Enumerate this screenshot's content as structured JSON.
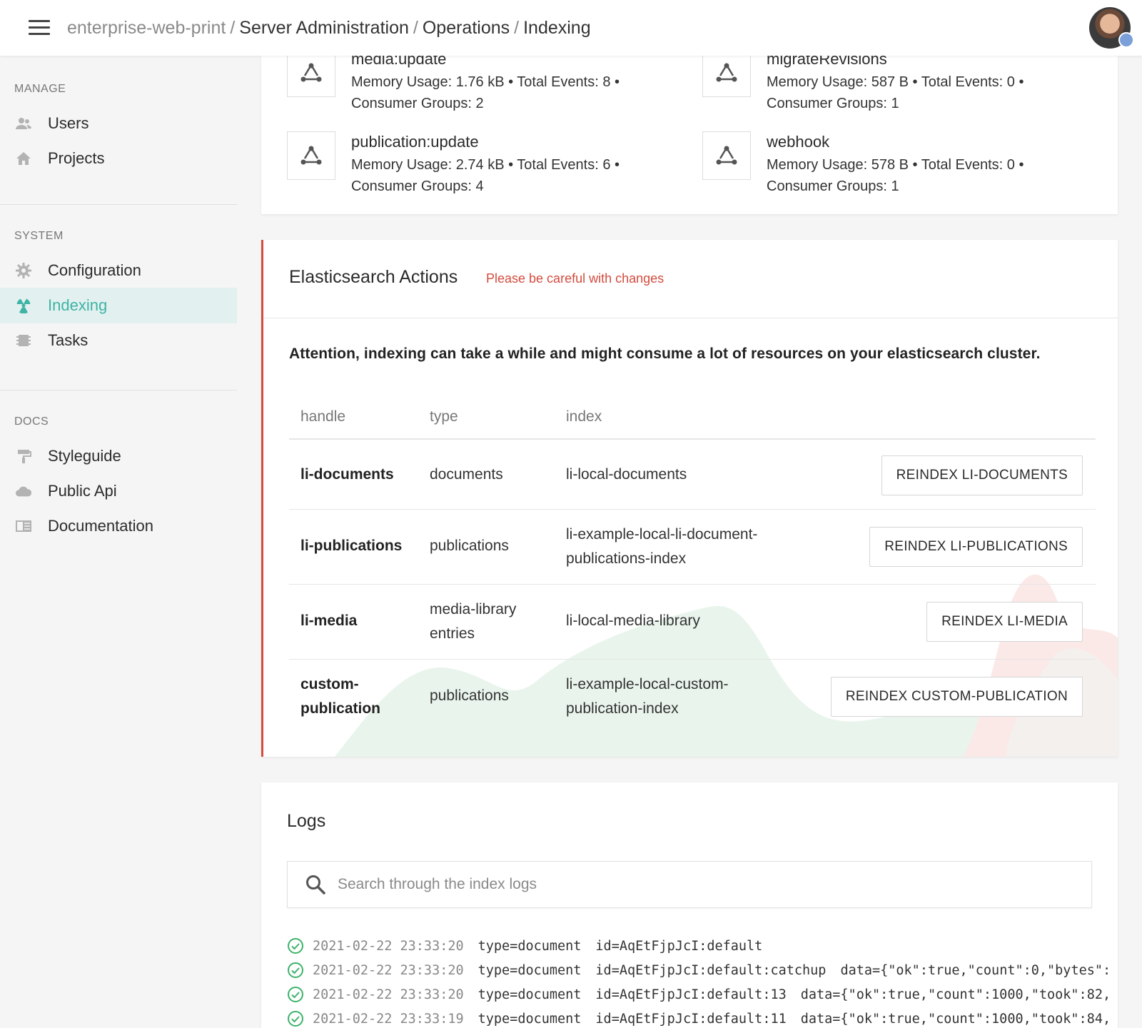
{
  "header": {
    "breadcrumb_root": "enterprise-web-print",
    "breadcrumb_sep": "/",
    "breadcrumbs": [
      "Server Administration",
      "Operations",
      "Indexing"
    ]
  },
  "sidebar": {
    "sections": [
      {
        "heading": "MANAGE",
        "items": [
          {
            "label": "Users",
            "icon": "users-icon"
          },
          {
            "label": "Projects",
            "icon": "home-icon"
          }
        ]
      },
      {
        "heading": "SYSTEM",
        "items": [
          {
            "label": "Configuration",
            "icon": "gear-icon"
          },
          {
            "label": "Indexing",
            "icon": "radiation-icon",
            "active": true
          },
          {
            "label": "Tasks",
            "icon": "chip-icon"
          }
        ]
      },
      {
        "heading": "DOCS",
        "items": [
          {
            "label": "Styleguide",
            "icon": "paint-roller-icon"
          },
          {
            "label": "Public Api",
            "icon": "cloud-icon"
          },
          {
            "label": "Documentation",
            "icon": "book-icon"
          }
        ]
      }
    ]
  },
  "streams": [
    {
      "name": "media:update",
      "line1": "Memory Usage: 1.76 kB • Total Events: 8 •",
      "line2": "Consumer Groups: 2"
    },
    {
      "name": "migrateRevisions",
      "line1": "Memory Usage: 587 B • Total Events: 0 •",
      "line2": "Consumer Groups: 1"
    },
    {
      "name": "publication:update",
      "line1": "Memory Usage: 2.74 kB • Total Events: 6 •",
      "line2": "Consumer Groups: 4"
    },
    {
      "name": "webhook",
      "line1": "Memory Usage: 578 B • Total Events: 0 •",
      "line2": "Consumer Groups: 1"
    }
  ],
  "es_actions": {
    "title": "Elasticsearch Actions",
    "warning": "Please be careful with changes",
    "attention": "Attention, indexing can take a while and might consume a lot of resources on your elasticsearch cluster.",
    "columns": [
      "handle",
      "type",
      "index"
    ],
    "rows": [
      {
        "handle": [
          "li-documents"
        ],
        "type": [
          "documents"
        ],
        "index": [
          "li-local-documents"
        ],
        "button": "REINDEX LI-DOCUMENTS"
      },
      {
        "handle": [
          "li-publications"
        ],
        "type": [
          "publications"
        ],
        "index": [
          "li-example-local-li-document-",
          "publications-index"
        ],
        "button": "REINDEX LI-PUBLICATIONS"
      },
      {
        "handle": [
          "li-media"
        ],
        "type": [
          "media-library",
          "entries"
        ],
        "index": [
          "li-local-media-library"
        ],
        "button": "REINDEX LI-MEDIA"
      },
      {
        "handle": [
          "custom-",
          "publication"
        ],
        "type": [
          "publications"
        ],
        "index": [
          "li-example-local-custom-",
          "publication-index"
        ],
        "button": "REINDEX CUSTOM-PUBLICATION"
      }
    ]
  },
  "logs": {
    "title": "Logs",
    "search_placeholder": "Search through the index logs",
    "entries": [
      {
        "ts": "2021-02-22 23:33:20",
        "type": "type=document",
        "id": "id=AqEtFjpJcI:default",
        "data": ""
      },
      {
        "ts": "2021-02-22 23:33:20",
        "type": "type=document",
        "id": "id=AqEtFjpJcI:default:catchup",
        "data": "data={\"ok\":true,\"count\":0,\"bytes\":"
      },
      {
        "ts": "2021-02-22 23:33:20",
        "type": "type=document",
        "id": "id=AqEtFjpJcI:default:13",
        "data": "data={\"ok\":true,\"count\":1000,\"took\":82,"
      },
      {
        "ts": "2021-02-22 23:33:19",
        "type": "type=document",
        "id": "id=AqEtFjpJcI:default:11",
        "data": "data={\"ok\":true,\"count\":1000,\"took\":84,"
      }
    ]
  },
  "colors": {
    "accent": "#3fb3a5",
    "danger": "#d34c3f",
    "success": "#3db36a"
  }
}
